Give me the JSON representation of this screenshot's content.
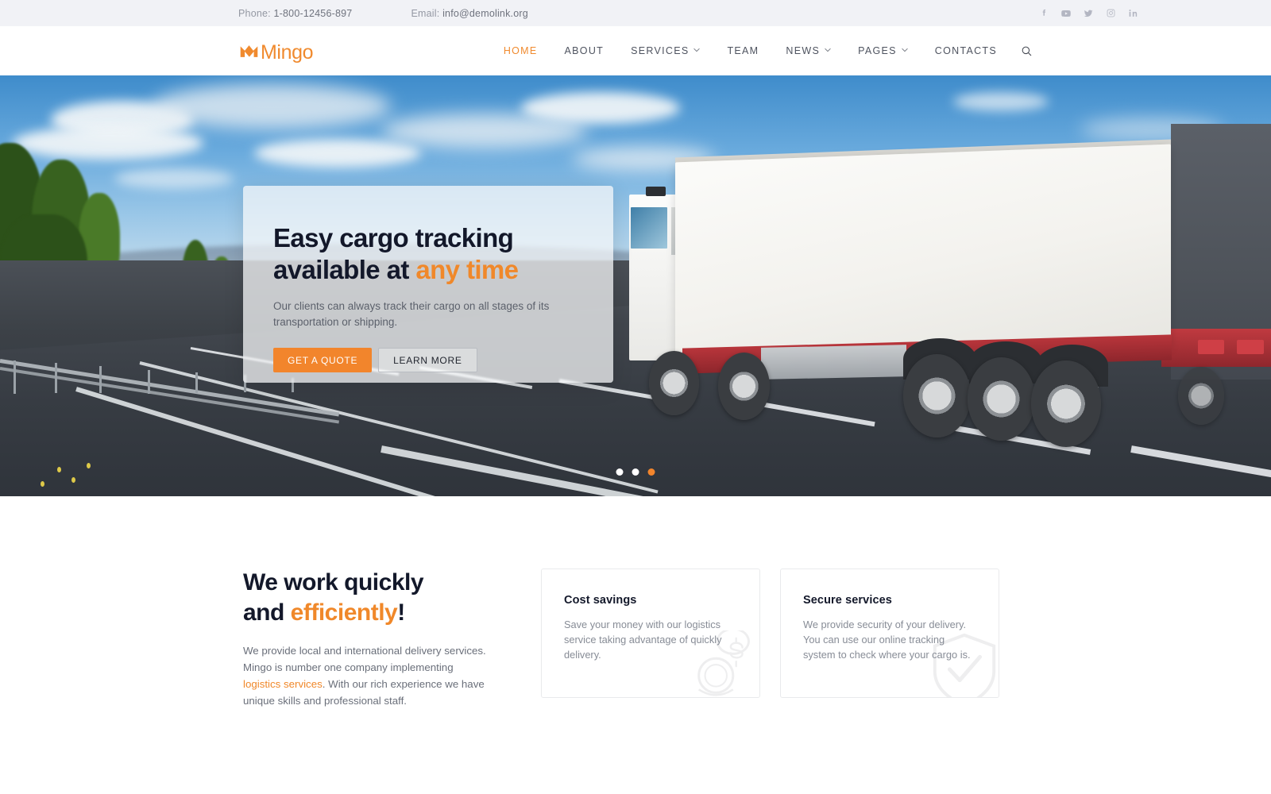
{
  "topbar": {
    "phone_label": "Phone:",
    "phone_value": "1-800-12456-897",
    "email_label": "Email:",
    "email_value": "info@demolink.org",
    "socials": [
      {
        "name": "facebook-icon",
        "label": "Facebook"
      },
      {
        "name": "youtube-icon",
        "label": "YouTube"
      },
      {
        "name": "twitter-icon",
        "label": "Twitter"
      },
      {
        "name": "instagram-icon",
        "label": "Instagram"
      },
      {
        "name": "linkedin-icon",
        "label": "LinkedIn"
      }
    ],
    "bg_color": "#f1f2f6"
  },
  "header": {
    "logo_text": "Mingo",
    "logo_color": "#f08a2e",
    "nav": [
      {
        "label": "HOME",
        "active": true,
        "dropdown": false
      },
      {
        "label": "ABOUT",
        "active": false,
        "dropdown": false
      },
      {
        "label": "SERVICES",
        "active": false,
        "dropdown": true
      },
      {
        "label": "TEAM",
        "active": false,
        "dropdown": false
      },
      {
        "label": "NEWS",
        "active": false,
        "dropdown": true
      },
      {
        "label": "PAGES",
        "active": false,
        "dropdown": true
      },
      {
        "label": "CONTACTS",
        "active": false,
        "dropdown": false
      }
    ],
    "search_icon": "search-icon"
  },
  "hero": {
    "title_line1": "Easy cargo tracking",
    "title_line2_plain": "available at ",
    "title_line2_accent": "any time",
    "subtitle": "Our clients can always track their cargo on all stages of its transportation or shipping.",
    "primary_button": "GET A QUOTE",
    "secondary_button": "LEARN MORE",
    "accent_color": "#f2852c",
    "slides_total": 3,
    "active_slide": 3,
    "image_alt": "White semi truck with cargo trailer driving on a highway"
  },
  "features": {
    "heading_line1": "We work quickly",
    "heading_line2_plain": "and ",
    "heading_line2_accent": "efficiently",
    "heading_line2_end": "!",
    "body_part1": "We provide local and international delivery services. Mingo is number one company implementing ",
    "body_link": "logistics services",
    "body_part2": ". With our rich experience we have unique skills and professional staff.",
    "cards": [
      {
        "title": "Cost savings",
        "text": "Save your money with our logistics service taking advantage of quickly delivery.",
        "watermark": "money-icon"
      },
      {
        "title": "Secure services",
        "text": "We provide security of your delivery. You can use our online tracking system to check where your cargo is.",
        "watermark": "shield-check-icon"
      }
    ]
  }
}
